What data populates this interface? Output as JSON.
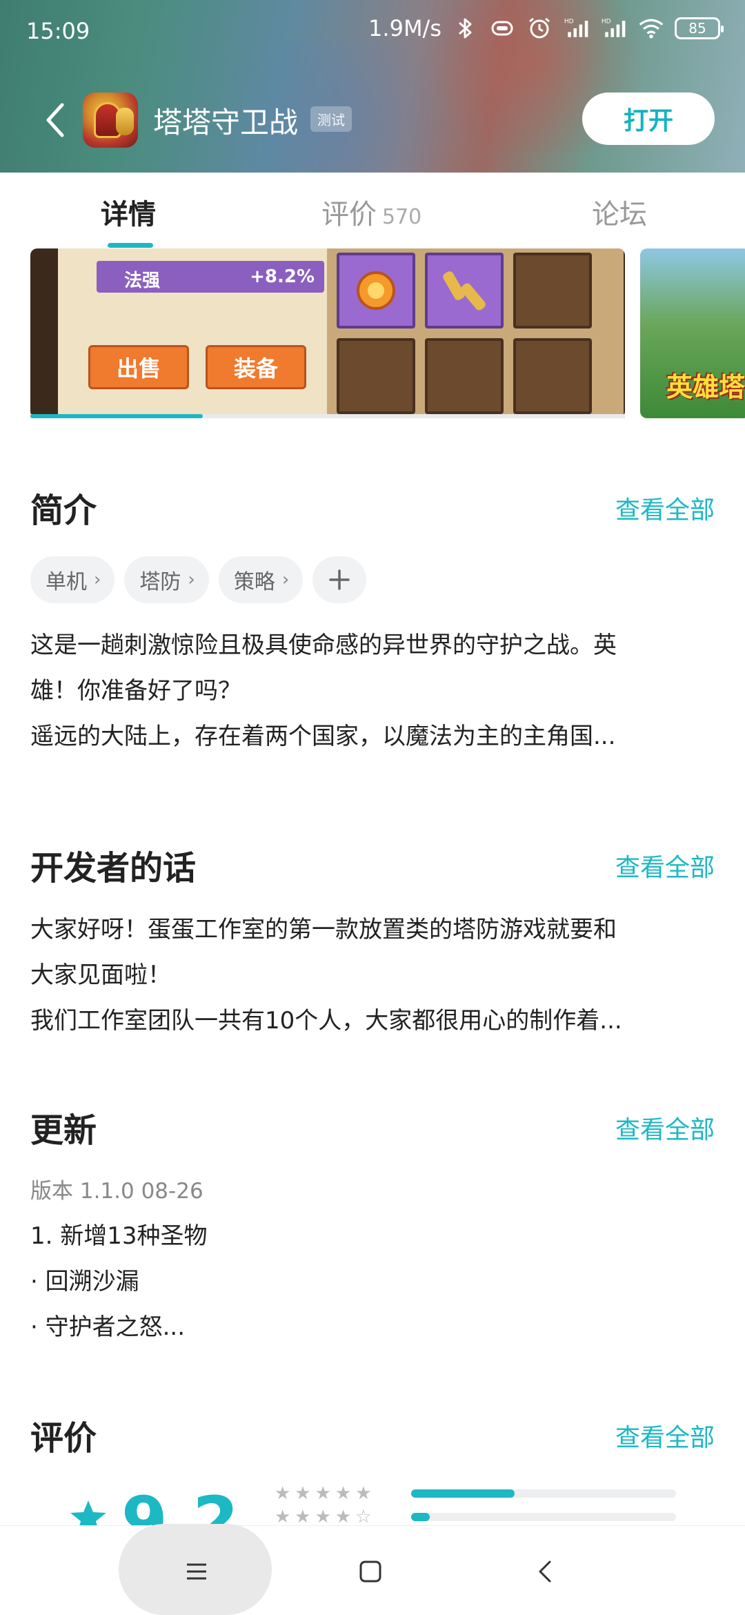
{
  "status_bar": {
    "time": "15:09",
    "speed": "1.9M/s",
    "battery": "85"
  },
  "app_bar": {
    "title": "塔塔守卫战",
    "badge": "测试",
    "open_label": "打开"
  },
  "tabs": [
    {
      "label": "详情",
      "active": true
    },
    {
      "label": "评价",
      "count": "570",
      "active": false
    },
    {
      "label": "论坛",
      "active": false
    }
  ],
  "screenshots": {
    "stat_label": "法强",
    "stat_value": "+8.2%",
    "sell_label": "出售",
    "equip_label": "装备",
    "second_logo": "英雄塔",
    "scroll_progress": 0.29
  },
  "intro": {
    "title": "简介",
    "see_all": "查看全部",
    "tags": [
      "单机",
      "塔防",
      "策略"
    ],
    "lines": [
      "这是一趟刺激惊险且极具使命感的异世界的守护之战。英",
      "雄！你准备好了吗？",
      "遥远的大陆上，存在着两个国家，以魔法为主的主角国..."
    ]
  },
  "developer": {
    "title": "开发者的话",
    "see_all": "查看全部",
    "lines": [
      "大家好呀！蛋蛋工作室的第一款放置类的塔防游戏就要和",
      "大家见面啦！",
      "我们工作室团队一共有10个人，大家都很用心的制作着..."
    ]
  },
  "update": {
    "title": "更新",
    "see_all": "查看全部",
    "version": "版本 1.1.0   08-26",
    "lines": [
      "1. 新增13种圣物",
      "· 回溯沙漏",
      "· 守护者之怒..."
    ]
  },
  "reviews": {
    "title": "评价",
    "see_all": "查看全部",
    "score": "9.2",
    "distribution": [
      {
        "stars": 5,
        "fraction": 0.39
      },
      {
        "stars": 4,
        "fraction": 0.07
      }
    ]
  },
  "colors": {
    "accent": "#1cb8c4"
  }
}
